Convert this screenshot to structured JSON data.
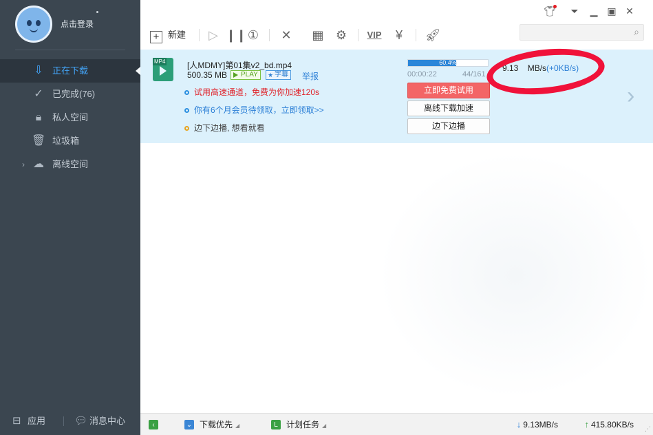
{
  "sidebar": {
    "login_text": "点击登录",
    "nav": [
      {
        "label": "正在下载",
        "icon": "download-arrow-icon",
        "active": true
      },
      {
        "label": "已完成(76)",
        "icon": "check-circle-icon",
        "active": false
      },
      {
        "label": "私人空间",
        "icon": "lock-icon",
        "active": false
      },
      {
        "label": "垃圾箱",
        "icon": "trash-icon",
        "active": false
      },
      {
        "label": "离线空间",
        "icon": "cloud-icon",
        "active": false
      }
    ],
    "bottom": {
      "apps_label": "应用",
      "messages_label": "消息中心"
    }
  },
  "toolbar": {
    "new_label": "新建",
    "icons": [
      "new-icon",
      "play-icon",
      "pause-icon",
      "speed-limit-icon",
      "delete-icon",
      "qrcode-icon",
      "settings-icon",
      "vip-icon",
      "money-icon",
      "rocket-icon"
    ]
  },
  "titlebar": {
    "icons": [
      "skin-icon",
      "menu-icon",
      "minimize-icon",
      "maximize-icon",
      "close-icon"
    ]
  },
  "task": {
    "file_type": "MP4",
    "file_name": "[人MDMY]第01集v2_bd.mp4",
    "file_size": "500.35 MB",
    "play_badge": "PLAY",
    "subtitle_badge": "字幕",
    "report_label": "举报",
    "hint1": "试用高速通道，免费为你加速120s",
    "hint2": "你有6个月会员待领取，立即领取>>",
    "hint3": "边下边播, 想看就看",
    "progress": 0.604,
    "progress_label": "60.4%",
    "time_elapsed": "00:00:22",
    "connections": "44/161",
    "btn_trial": "立即免费试用",
    "btn_offline": "离线下载加速",
    "btn_play": "边下边播",
    "speed_value": "9.13",
    "speed_unit": "MB/s",
    "speed_extra": "(+0KB/s)"
  },
  "statusbar": {
    "download_priority": "下载优先",
    "schedule": "计划任务",
    "download_speed": "9.13MB/s",
    "upload_speed": "415.80KB/s"
  },
  "colors": {
    "sidebar_bg": "#3b4650",
    "active_blue": "#43a4f7",
    "task_bg": "#dcf1fc",
    "annotation_red": "#f0123a",
    "trial_button": "#f36566"
  }
}
